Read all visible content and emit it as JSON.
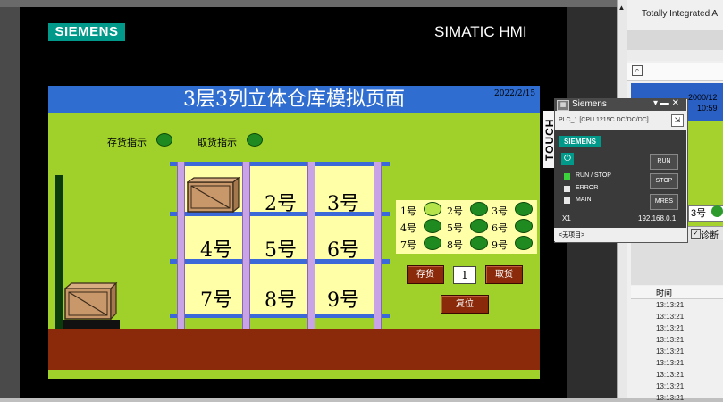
{
  "hmi": {
    "brand": "SIEMENS",
    "product": "SIMATIC HMI",
    "touch_label": "TOUCH",
    "screen": {
      "title": "3层3列立体仓库模拟页面",
      "date": "2022/2/15",
      "stock_in_indicator_label": "存货指示",
      "stock_out_indicator_label": "取货指示",
      "cells": [
        "",
        "2号",
        "3号",
        "4号",
        "5号",
        "6号",
        "7号",
        "8号",
        "9号"
      ],
      "status_panel": [
        {
          "label": "1号",
          "state": "on"
        },
        {
          "label": "2号",
          "state": "off"
        },
        {
          "label": "3号",
          "state": "off"
        },
        {
          "label": "4号",
          "state": "off"
        },
        {
          "label": "5号",
          "state": "off"
        },
        {
          "label": "6号",
          "state": "off"
        },
        {
          "label": "7号",
          "state": "off"
        },
        {
          "label": "8号",
          "state": "off"
        },
        {
          "label": "9号",
          "state": "off"
        }
      ],
      "store_button": "存货",
      "retrieve_button": "取货",
      "quantity_value": "1",
      "reset_button": "复位"
    }
  },
  "plcsim": {
    "window_title": "Siemens",
    "window_controls": "▾ ▬ ✕",
    "device": "PLC_1 [CPU 1215C DC/DC/DC]",
    "brand": "SIEMENS",
    "indicators": [
      {
        "label": "RUN / STOP",
        "color": "#3cd23c"
      },
      {
        "label": "ERROR",
        "color": "#e8e8e8"
      },
      {
        "label": "MAINT",
        "color": "#e8e8e8"
      }
    ],
    "buttons": [
      "RUN",
      "STOP",
      "MRES"
    ],
    "interface": "X1",
    "ip": "192.168.0.1",
    "project": "<无项目>"
  },
  "tia": {
    "header": "Totally Integrated A",
    "clock_line1": "2000/12",
    "clock_line2": "10:59",
    "mini_cell": "3号",
    "diag_tab": "诊断",
    "list_header": "时间",
    "list_times": [
      "13:13:21",
      "13:13:21",
      "13:13:21",
      "13:13:21",
      "13:13:21",
      "13:13:21",
      "13:13:21",
      "13:13:21",
      "13:13:21"
    ]
  }
}
